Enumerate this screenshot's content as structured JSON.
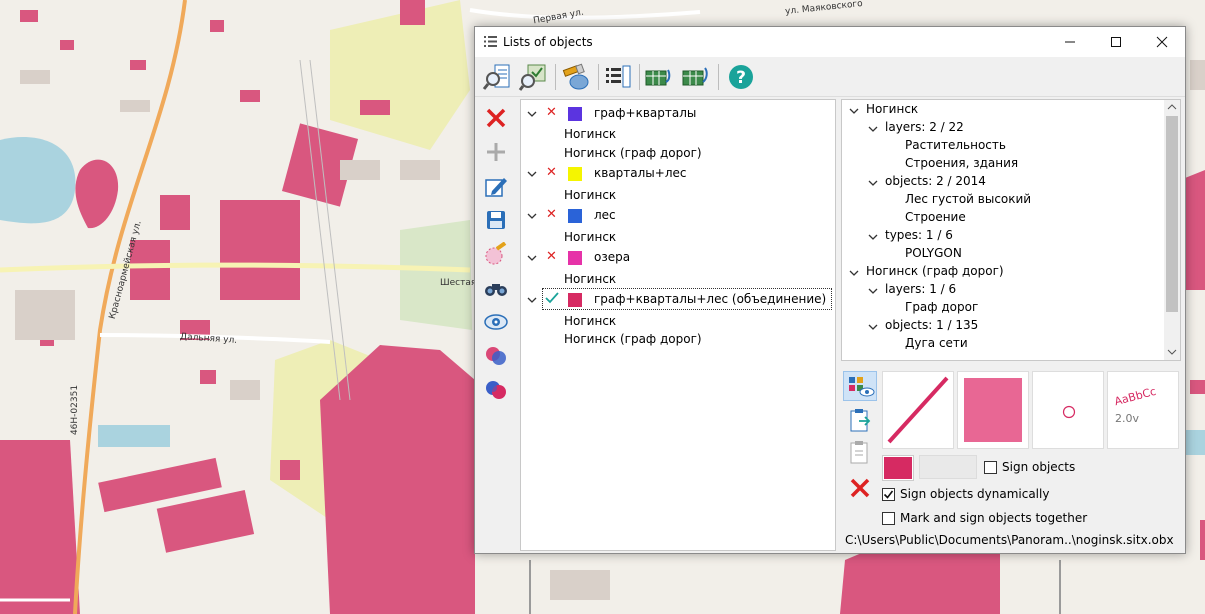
{
  "map": {
    "labels": {
      "pervaya_ul": "Первая ул.",
      "mayakovskogo": "ул. Маяковского",
      "shestaya": "Шестая",
      "dalnyaya": "Дальняя ул.",
      "road_code": "46Н-02351",
      "krasnoarmeyskaya": "Красноармейская ул."
    }
  },
  "window": {
    "title": "Lists of objects",
    "title_icon": "list-icon"
  },
  "toolbar": {
    "icons": [
      "zoom-list-icon",
      "map-search-icon",
      "flashlight-icon",
      "list-layers-icon",
      "export-table-icon",
      "import-table-icon",
      "help-icon"
    ]
  },
  "vertical_toolbar": {
    "icons": [
      "delete-icon",
      "add-icon",
      "edit-icon",
      "save-icon",
      "select-area-icon",
      "binoculars-icon",
      "eye-icon",
      "intersect-icon",
      "union-icon"
    ]
  },
  "lists": [
    {
      "name": "граф+кварталы",
      "color": "#5b34e0",
      "status": "x",
      "maps": [
        "Ногинск",
        "Ногинск (граф дорог)"
      ]
    },
    {
      "name": "кварталы+лес",
      "color": "#f5f500",
      "status": "x",
      "maps": [
        "Ногинск"
      ]
    },
    {
      "name": "лес",
      "color": "#2a63d8",
      "status": "x",
      "maps": [
        "Ногинск"
      ]
    },
    {
      "name": "озера",
      "color": "#e632a8",
      "status": "x",
      "maps": [
        "Ногинск"
      ]
    },
    {
      "name": "граф+кварталы+лес (объединение)",
      "color": "#d62a62",
      "status": "check",
      "maps": [
        "Ногинск",
        "Ногинск (граф дорог)"
      ]
    }
  ],
  "tree": {
    "rows": [
      {
        "level": 0,
        "expand": true,
        "text": "Ногинск"
      },
      {
        "level": 1,
        "expand": true,
        "text": "layers: 2 / 22"
      },
      {
        "level": 2,
        "expand": false,
        "text": "Растительность"
      },
      {
        "level": 2,
        "expand": false,
        "text": "Строения, здания"
      },
      {
        "level": 1,
        "expand": true,
        "text": "objects: 2 / 2014"
      },
      {
        "level": 2,
        "expand": false,
        "text": "Лес густой высокий"
      },
      {
        "level": 2,
        "expand": false,
        "text": "Строение"
      },
      {
        "level": 1,
        "expand": true,
        "text": "types: 1 / 6"
      },
      {
        "level": 2,
        "expand": false,
        "text": "POLYGON"
      },
      {
        "level": 0,
        "expand": true,
        "text": "Ногинск (граф дорог)"
      },
      {
        "level": 1,
        "expand": true,
        "text": "layers: 1 / 6"
      },
      {
        "level": 2,
        "expand": false,
        "text": "Граф дорог"
      },
      {
        "level": 1,
        "expand": true,
        "text": "objects: 1 / 135"
      },
      {
        "level": 2,
        "expand": false,
        "text": "Дуга сети"
      }
    ]
  },
  "properties": {
    "style_preview_text": "AaBbCc",
    "style_preview_size": "2.0v",
    "accent_color": "#d62a62",
    "sign_objects_label": "Sign objects",
    "sign_objects_checked": false,
    "sign_dynamic_label": "Sign objects dynamically",
    "sign_dynamic_checked": true,
    "mark_sign_together_label": "Mark and sign objects together",
    "mark_sign_together_checked": false
  },
  "status": {
    "path": "C:\\Users\\Public\\Documents\\Panoram..\\noginsk.sitx.obx"
  }
}
